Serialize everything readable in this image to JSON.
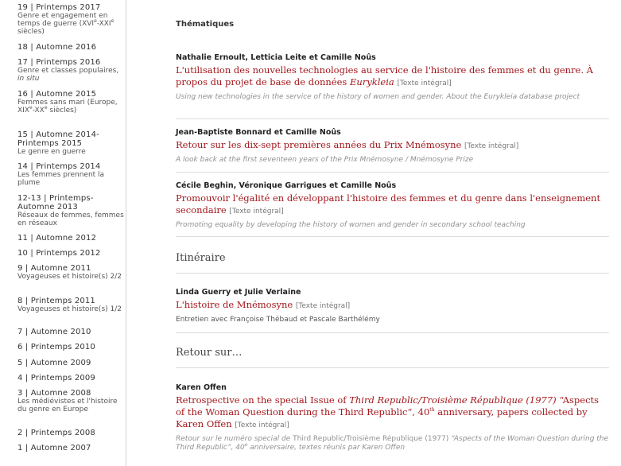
{
  "sidebar": {
    "issues": [
      {
        "title": "19 | Printemps 2017",
        "subtitle": [
          "Genre et engagement en temps de guerre (XVI",
          "e",
          "-XXI",
          "e",
          " siècles)"
        ]
      },
      {
        "title": "18 | Automne 2016"
      },
      {
        "title": "17 | Printemps 2016",
        "subtitle_text": "Genre et classes populaires, ",
        "subtitle_italic": "in situ"
      },
      {
        "title": "16 | Automne 2015",
        "subtitle": [
          "Femmes sans mari (Europe, XIX",
          "e",
          "-XX",
          "e",
          " siècles)"
        ]
      },
      {
        "title": "15 | Automne 2014-Printemps 2015",
        "subtitle_text": "Le genre en guerre"
      },
      {
        "title": "14 | Printemps 2014",
        "subtitle_text": "Les femmes prennent la plume"
      },
      {
        "title": "12-13 | Printemps-Automne 2013",
        "subtitle_text": "Réseaux de femmes, femmes en réseaux"
      },
      {
        "title": "11 | Automne 2012"
      },
      {
        "title": "10 | Printemps 2012"
      },
      {
        "title": "9 | Automne 2011",
        "subtitle_text": "Voyageuses et histoire(s) 2/2"
      },
      {
        "title": "8 | Printemps 2011",
        "subtitle_text": "Voyageuses et histoire(s) 1/2"
      },
      {
        "title": "7 | Automne 2010"
      },
      {
        "title": "6 | Printemps 2010"
      },
      {
        "title": "5 | Automne 2009"
      },
      {
        "title": "4 | Printemps 2009"
      },
      {
        "title": "3 | Automne 2008",
        "subtitle_text": "Les médiévistes et l'histoire du genre en Europe"
      },
      {
        "title": "2 | Printemps 2008"
      },
      {
        "title": "1 | Automne 2007"
      }
    ]
  },
  "main": {
    "section_thematiques": "Thématiques",
    "texte_integral": "[Texte intégral]",
    "thematiques": [
      {
        "authors": "Nathalie Ernoult, Letticia Leite et Camille Noûs",
        "title_text": "L'utilisation des nouvelles technologies au service de l'histoire des femmes et du genre. À propos du projet de base de données ",
        "title_italic": "Eurykleia",
        "translation": "Using new technologies in the service of the history of women and gender. About the Eurykleia database project"
      },
      {
        "authors": "Jean-Baptiste Bonnard et Camille Noûs",
        "title_text": "Retour sur les dix-sept premières années du Prix Mnémosyne",
        "translation": "A look back at the first seventeen years of the Prix Mnémosyne / Mnémosyne Prize"
      },
      {
        "authors": "Cécile Beghin, Véronique Garrigues et Camille Noûs",
        "title_text": "Promouvoir l'égalité en développant l'histoire des femmes et du genre dans l'enseignement secondaire",
        "translation": "Promoting equality by developing the history of women and gender in secondary school teaching"
      }
    ],
    "heading_itineraire": "Itinéraire",
    "itineraire": {
      "authors": "Linda Guerry et Julie Verlaine",
      "title_text": "L'histoire de Mnémosyne",
      "subtitle": "Entretien avec Françoise Thébaud et Pascale Barthélémy"
    },
    "heading_retour": "Retour sur…",
    "retour": {
      "authors": "Karen Offen",
      "title_part1": "Retrospective on the special Issue of ",
      "title_italic": "Third Republic/Troisième République (1977)",
      "title_part2": " “Aspects of the Woman Question during the Third Republic”, 40",
      "title_sup": "th",
      "title_part3": " anniversary, papers collected by Karen Offen",
      "translation_part1": "Retour sur le numéro special de ",
      "translation_normal": "Third Republic/Troisième République (1977)",
      "translation_part2": " “Aspects of the Woman Question during the Third Republic”, 40",
      "translation_sup": "e",
      "translation_part3": " anniversaire, textes réunis par Karen Offen"
    }
  }
}
